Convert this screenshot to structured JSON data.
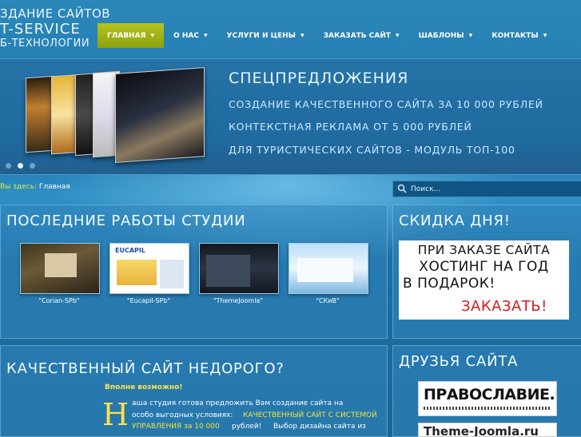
{
  "logo": {
    "line1": "ЗДАНИЕ САЙТОВ",
    "line2": "T-SERVICE",
    "line3": "Б-ТЕХНОЛОГИИ"
  },
  "nav": {
    "items": [
      {
        "label": "ГЛАВНАЯ"
      },
      {
        "label": "О НАС"
      },
      {
        "label": "УСЛУГИ И ЦЕНЫ"
      },
      {
        "label": "ЗАКАЗАТЬ САЙТ"
      },
      {
        "label": "ШАБЛОНЫ"
      },
      {
        "label": "КОНТАКТЫ"
      }
    ],
    "active_color": "#a7b819"
  },
  "slider": {
    "title": "СПЕЦПРЕДЛОЖЕНИЯ",
    "lines": [
      "СОЗДАНИЕ КАЧЕСТВЕННОГО САЙТА ЗА 10 000 РУБЛЕЙ",
      "КОНТЕКСТНАЯ РЕКЛАМА ОТ 5 000 РУБЛЕЙ",
      "ДЛЯ ТУРИСТИЧЕСКИХ САЙТОВ - МОДУЛЬ ТОП-100"
    ],
    "active_dot": 2
  },
  "breadcrumb": {
    "prefix": "Вы здесь:",
    "current": "Главная"
  },
  "search": {
    "placeholder": "Поиск..."
  },
  "works": {
    "title": "ПОСЛЕДНИЕ РАБОТЫ СТУДИИ",
    "items": [
      {
        "caption": "\"Corian-SPb\""
      },
      {
        "caption": "\"Eucapil-SPb\"",
        "logo_text": "EUCAPIL"
      },
      {
        "caption": "\"ThemeJoomla\""
      },
      {
        "caption": "\"СКиВ\""
      }
    ]
  },
  "discount": {
    "title": "СКИДКА ДНЯ!",
    "lines": [
      "ПРИ ЗАКАЗЕ САЙТА",
      "ХОСТИНГ НА ГОД",
      "В ПОДАРОК!"
    ],
    "order": "ЗАКАЗАТЬ!"
  },
  "quality": {
    "title": "КАЧЕСТВЕННЫЙ САЙТ НЕДОРОГО?",
    "subtitle": "Вполне возможно!",
    "dropcap": "Н",
    "line1": "аша студия готова предложить Вам создание сайта на",
    "line2a": "особо выгодных условиях:",
    "line2b": "КАЧЕСТВЕННЫЙ САЙТ С СИСТЕМОЙ",
    "line3a": "УПРАВЛЕНИЯ за 10 000",
    "line3b": "рублей!",
    "line3c": "Выбор дизайна сайта из"
  },
  "friends": {
    "title": "ДРУЗЬЯ САЙТА",
    "banner1": "ПРАВОСЛАВИЕ.RU",
    "banner2": "Theme-Joomla.ru"
  },
  "colors": {
    "accent_yellow": "#ffe14a",
    "link_yellow": "#f1e43c",
    "order_red": "#d21d1d"
  }
}
